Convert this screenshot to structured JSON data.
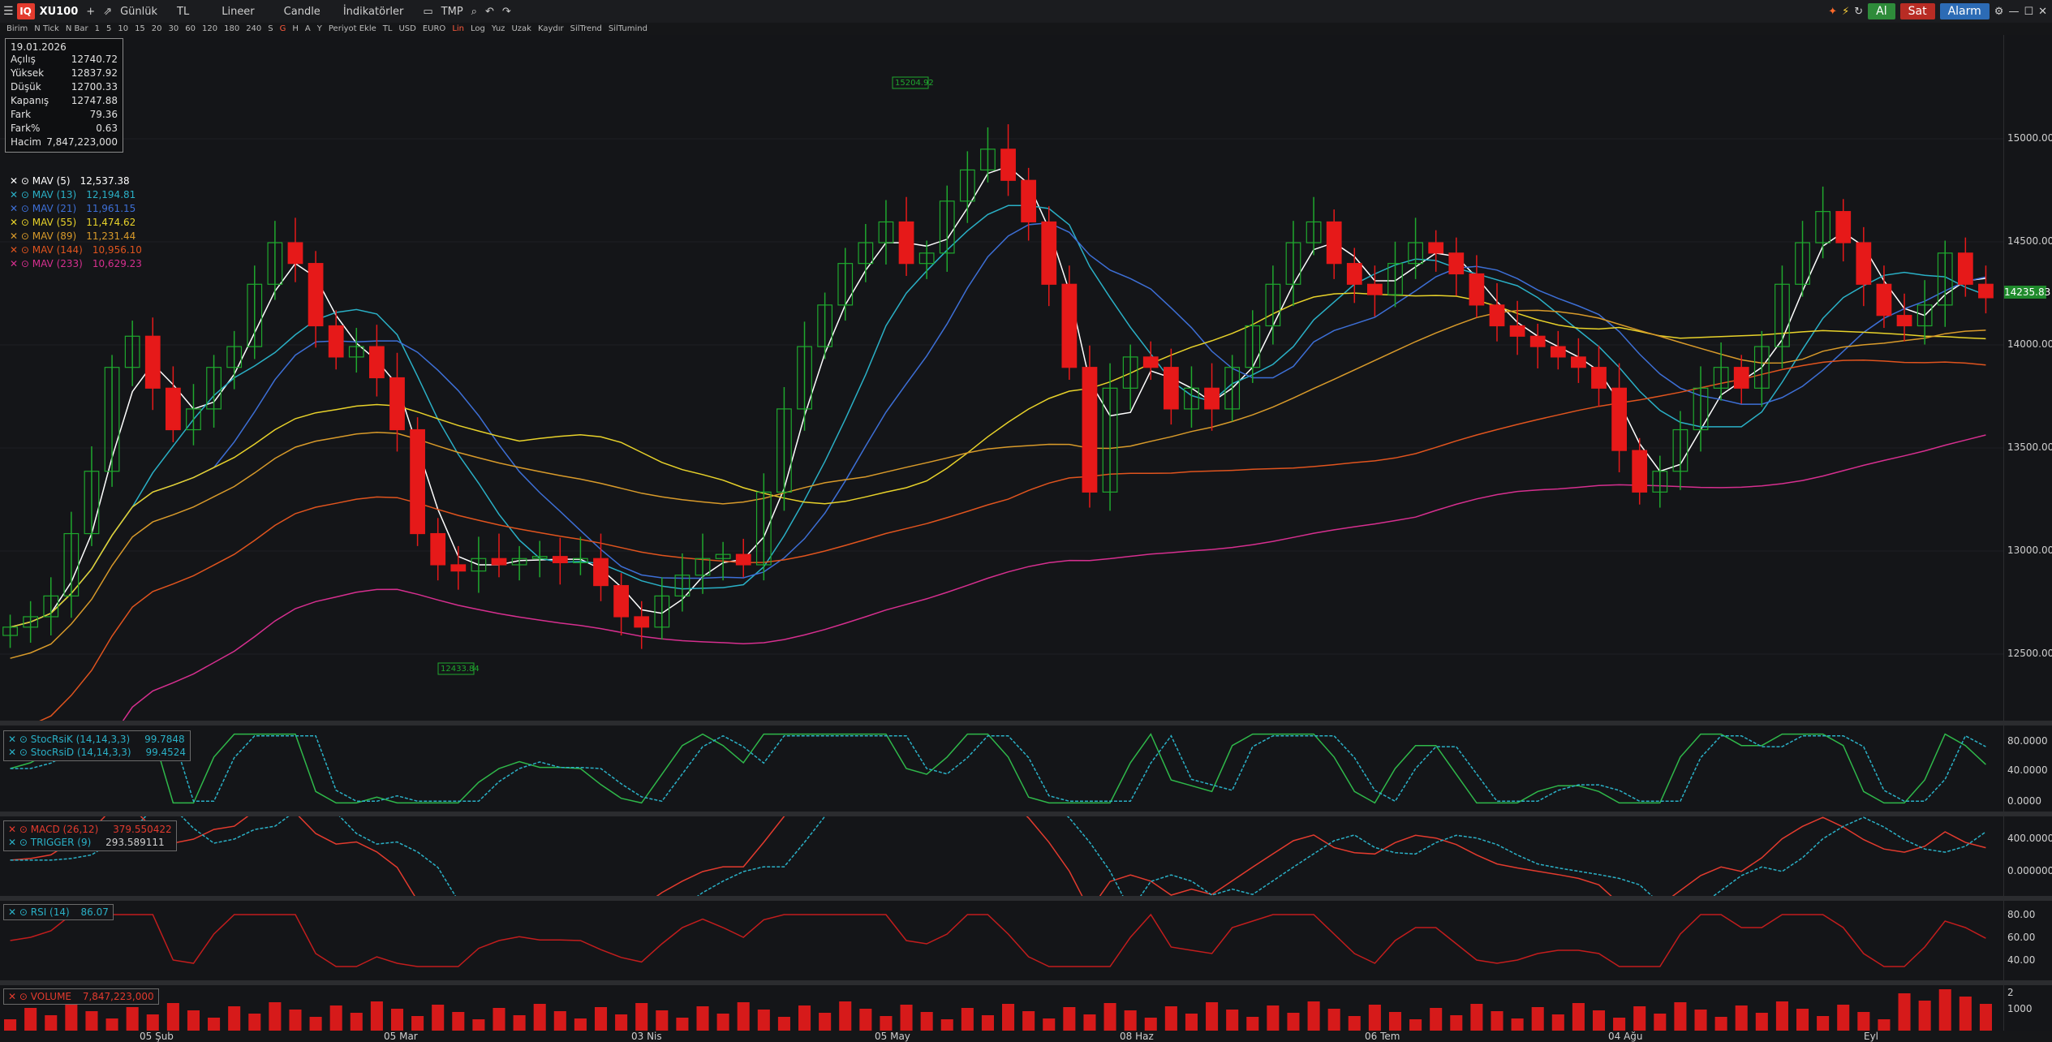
{
  "toolbar": {
    "logo": "IQ",
    "symbol": "XU100",
    "plus": "+",
    "period": "Günlük",
    "currency": "TL",
    "scale": "Lineer",
    "chart_type": "Candle",
    "indicators": "İndikatörler",
    "tmp": "TMP",
    "buy": "Al",
    "sell": "Sat",
    "alarm": "Alarm"
  },
  "subtoolbar": [
    "Birim",
    "N Tick",
    "N Bar",
    "1",
    "5",
    "10",
    "15",
    "20",
    "30",
    "60",
    "120",
    "180",
    "240",
    "S",
    "G",
    "H",
    "A",
    "Y",
    "Periyot Ekle",
    "TL",
    "USD",
    "EURO",
    "Lin",
    "Log",
    "Yuz",
    "Uzak",
    "Kaydır",
    "SilTrend",
    "SilTumind"
  ],
  "info": {
    "date": "19.01.2026",
    "rows": [
      {
        "label": "Açılış",
        "value": "12740.72"
      },
      {
        "label": "Yüksek",
        "value": "12837.92"
      },
      {
        "label": "Düşük",
        "value": "12700.33"
      },
      {
        "label": "Kapanış",
        "value": "12747.88"
      },
      {
        "label": "Fark",
        "value": "79.36"
      },
      {
        "label": "Fark%",
        "value": "0.63"
      },
      {
        "label": "Hacim",
        "value": "7,847,223,000"
      }
    ]
  },
  "mav_legend": [
    {
      "name": "MAV (5)",
      "value": "12,537.38",
      "color": "#ffffff"
    },
    {
      "name": "MAV (13)",
      "value": "12,194.81",
      "color": "#2ab0c6"
    },
    {
      "name": "MAV (21)",
      "value": "11,961.15",
      "color": "#3d6fd6"
    },
    {
      "name": "MAV (55)",
      "value": "11,474.62",
      "color": "#e8d22a"
    },
    {
      "name": "MAV (89)",
      "value": "11,231.44",
      "color": "#d89a2a"
    },
    {
      "name": "MAV (144)",
      "value": "10,956.10",
      "color": "#e0541e"
    },
    {
      "name": "MAV (233)",
      "value": "10,629.23",
      "color": "#d62f8f"
    }
  ],
  "price_axis": [
    "15000.00",
    "14500.00",
    "14000.00",
    "13500.00",
    "13000.00",
    "12500.00"
  ],
  "last_price": "14235.83",
  "annotations": {
    "high": "15204.92",
    "low": "12433.84"
  },
  "stoch": {
    "k_name": "StocRsiK (14,14,3,3)",
    "k_value": "99.7848",
    "d_name": "StocRsiD (14,14,3,3)",
    "d_value": "99.4524",
    "axis": [
      "80.0000",
      "40.0000",
      "0.0000"
    ]
  },
  "macd": {
    "name": "MACD (26,12)",
    "value": "379.550422",
    "trig_name": "TRIGGER (9)",
    "trig_value": "293.589111",
    "axis": [
      "400.0000",
      "0.000000"
    ]
  },
  "rsi": {
    "name": "RSI (14)",
    "value": "86.07",
    "axis": [
      "80.00",
      "60.00",
      "40.00"
    ]
  },
  "volume": {
    "name": "VOLUME",
    "value": "7,847,223,000",
    "axis": [
      "2",
      "1000"
    ]
  },
  "date_axis": [
    "05 Şub",
    "05 Mar",
    "03 Nis",
    "05 May",
    "08 Haz",
    "06 Tem",
    "04 Ağu",
    "Eyl"
  ],
  "chart_data": {
    "type": "candlestick",
    "series": [
      {
        "name": "XU100",
        "close": [
          12650,
          12700,
          12800,
          13100,
          13400,
          13900,
          14050,
          13800,
          13600,
          13700,
          13900,
          14000,
          14300,
          14500,
          14400,
          14100,
          13950,
          14000,
          13850,
          13600,
          13100,
          12950,
          12920,
          12980,
          12950,
          12980,
          12990,
          12960,
          12980,
          12850,
          12700,
          12650,
          12800,
          12900,
          12980,
          13000,
          12950,
          13300,
          13700,
          14000,
          14200,
          14400,
          14500,
          14600,
          14400,
          14450,
          14700,
          14850,
          14950,
          14800,
          14600,
          14300,
          13900,
          13300,
          13800,
          13950,
          13900,
          13700,
          13800,
          13700,
          13900,
          14100,
          14300,
          14500,
          14600,
          14400,
          14300,
          14250,
          14400,
          14500,
          14450,
          14350,
          14200,
          14100,
          14050,
          14000,
          13950,
          13900,
          13800,
          13500,
          13300,
          13400,
          13600,
          13800,
          13900,
          13800,
          14000,
          14300,
          14500,
          14650,
          14500,
          14300,
          14150,
          14100,
          14200,
          14450,
          14300,
          14235
        ]
      }
    ]
  }
}
